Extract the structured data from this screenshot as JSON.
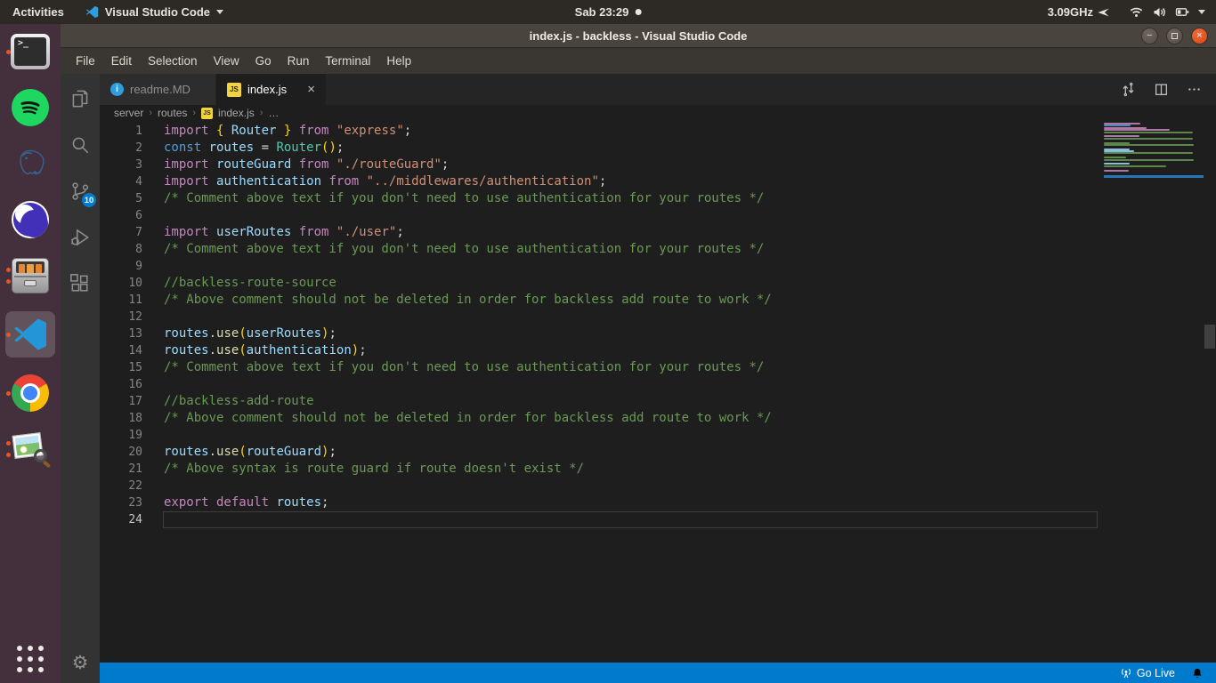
{
  "system_bar": {
    "activities": "Activities",
    "app_name": "Visual Studio Code",
    "clock": "Sab 23:29",
    "cpu": "3.09GHz"
  },
  "window": {
    "title": "index.js - backless - Visual Studio Code"
  },
  "menu": {
    "items": [
      "File",
      "Edit",
      "Selection",
      "View",
      "Go",
      "Run",
      "Terminal",
      "Help"
    ]
  },
  "tabs": {
    "readme": {
      "label": "readme.MD",
      "icon": "info"
    },
    "index": {
      "label": "index.js",
      "icon": "js",
      "js_glyph": "JS",
      "close": "×"
    }
  },
  "breadcrumb": {
    "folder1": "server",
    "folder2": "routes",
    "file": "index.js",
    "more": "…"
  },
  "activity_bar": {
    "source_control_badge": "10",
    "gear": "⚙"
  },
  "status_bar": {
    "go_live": "Go Live"
  },
  "window_controls": {
    "minimize": "−",
    "close": "×"
  },
  "dock": {
    "items": [
      {
        "name": "terminal",
        "dots": 1,
        "active": false
      },
      {
        "name": "spotify",
        "dots": 0,
        "active": false
      },
      {
        "name": "postgresql",
        "dots": 0,
        "active": false
      },
      {
        "name": "insomnia",
        "dots": 0,
        "active": false
      },
      {
        "name": "file-manager",
        "dots": 2,
        "active": false
      },
      {
        "name": "vscode",
        "dots": 1,
        "active": true
      },
      {
        "name": "chrome",
        "dots": 1,
        "active": false
      },
      {
        "name": "image-viewer",
        "dots": 2,
        "active": false
      }
    ],
    "terminal_prompt": ">_"
  },
  "editor": {
    "current_line": 24,
    "palette": {
      "k": "#C586C0",
      "s": "#569CD6",
      "v": "#9CDCFE",
      "f": "#DCDCAA",
      "t": "#4EC9B0",
      "str": "#CE9178",
      "c": "#6A9955",
      "p": "#D4D4D4",
      "b": "#FFD700"
    },
    "lines": [
      [
        [
          "k",
          "import "
        ],
        [
          "b",
          "{ "
        ],
        [
          "v",
          "Router"
        ],
        [
          "b",
          " }"
        ],
        [
          "k",
          " from "
        ],
        [
          "str",
          "\"express\""
        ],
        [
          "p",
          ";"
        ]
      ],
      [
        [
          "s",
          "const "
        ],
        [
          "v",
          "routes"
        ],
        [
          "p",
          " = "
        ],
        [
          "t",
          "Router"
        ],
        [
          "b",
          "()"
        ],
        [
          "p",
          ";"
        ]
      ],
      [
        [
          "k",
          "import "
        ],
        [
          "v",
          "routeGuard"
        ],
        [
          "k",
          " from "
        ],
        [
          "str",
          "\"./routeGuard\""
        ],
        [
          "p",
          ";"
        ]
      ],
      [
        [
          "k",
          "import "
        ],
        [
          "v",
          "authentication"
        ],
        [
          "k",
          " from "
        ],
        [
          "str",
          "\"../middlewares/authentication\""
        ],
        [
          "p",
          ";"
        ]
      ],
      [
        [
          "c",
          "/* Comment above text if you don't need to use authentication for your routes */"
        ]
      ],
      [],
      [
        [
          "k",
          "import "
        ],
        [
          "v",
          "userRoutes"
        ],
        [
          "k",
          " from "
        ],
        [
          "str",
          "\"./user\""
        ],
        [
          "p",
          ";"
        ]
      ],
      [
        [
          "c",
          "/* Comment above text if you don't need to use authentication for your routes */"
        ]
      ],
      [],
      [
        [
          "c",
          "//backless-route-source"
        ]
      ],
      [
        [
          "c",
          "/* Above comment should not be deleted in order for backless add route to work */"
        ]
      ],
      [],
      [
        [
          "v",
          "routes"
        ],
        [
          "p",
          "."
        ],
        [
          "f",
          "use"
        ],
        [
          "b",
          "("
        ],
        [
          "v",
          "userRoutes"
        ],
        [
          "b",
          ")"
        ],
        [
          "p",
          ";"
        ]
      ],
      [
        [
          "v",
          "routes"
        ],
        [
          "p",
          "."
        ],
        [
          "f",
          "use"
        ],
        [
          "b",
          "("
        ],
        [
          "v",
          "authentication"
        ],
        [
          "b",
          ")"
        ],
        [
          "p",
          ";"
        ]
      ],
      [
        [
          "c",
          "/* Comment above text if you don't need to use authentication for your routes */"
        ]
      ],
      [],
      [
        [
          "c",
          "//backless-add-route"
        ]
      ],
      [
        [
          "c",
          "/* Above comment should not be deleted in order for backless add route to work */"
        ]
      ],
      [],
      [
        [
          "v",
          "routes"
        ],
        [
          "p",
          "."
        ],
        [
          "f",
          "use"
        ],
        [
          "b",
          "("
        ],
        [
          "v",
          "routeGuard"
        ],
        [
          "b",
          ")"
        ],
        [
          "p",
          ";"
        ]
      ],
      [
        [
          "c",
          "/* Above syntax is route guard if route doesn't exist */"
        ]
      ],
      [],
      [
        [
          "k",
          "export default "
        ],
        [
          "v",
          "routes"
        ],
        [
          "p",
          ";"
        ]
      ],
      []
    ]
  }
}
